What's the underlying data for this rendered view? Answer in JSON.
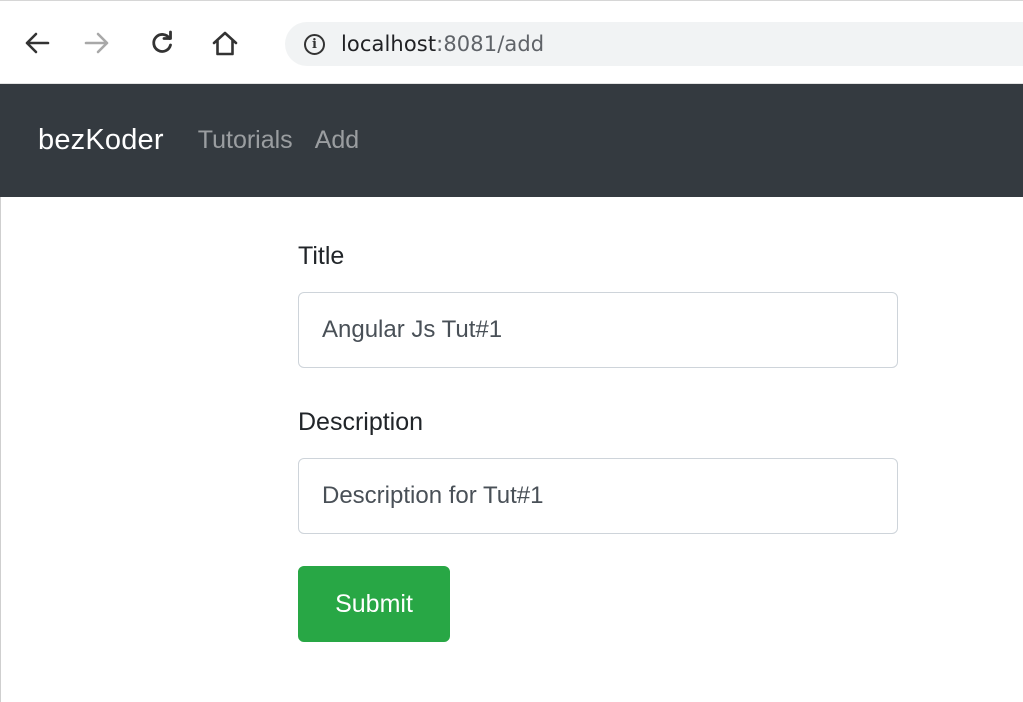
{
  "browser": {
    "url_host": "localhost",
    "url_path": ":8081/add",
    "info_icon_label": "i"
  },
  "navbar": {
    "brand": "bezKoder",
    "links": [
      {
        "label": "Tutorials"
      },
      {
        "label": "Add"
      }
    ]
  },
  "form": {
    "title_label": "Title",
    "title_value": "Angular Js Tut#1",
    "description_label": "Description",
    "description_value": "Description for Tut#1",
    "submit_label": "Submit"
  },
  "colors": {
    "navbar_bg": "#343a40",
    "submit_bg": "#28a745",
    "omnibox_bg": "#f1f3f4"
  },
  "icons": {
    "back": "arrow-left-icon",
    "forward": "arrow-right-icon",
    "reload": "reload-icon",
    "home": "home-icon",
    "info": "info-icon"
  }
}
